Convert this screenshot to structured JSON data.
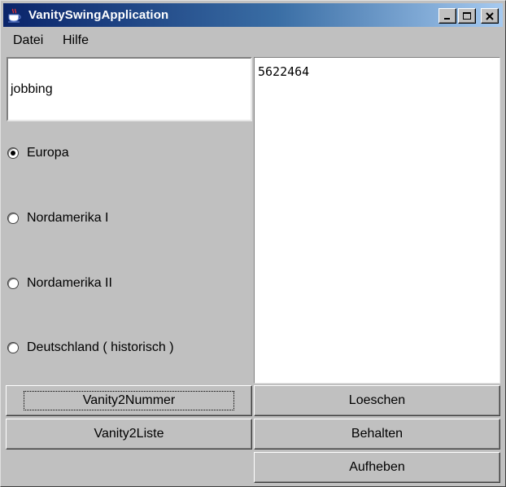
{
  "window": {
    "title": "VanitySwingApplication",
    "colors": {
      "titlebar_start": "#0a246a",
      "titlebar_end": "#a6caf0",
      "panel": "#c0c0c0"
    }
  },
  "menu": {
    "items": [
      {
        "label": "Datei"
      },
      {
        "label": "Hilfe"
      }
    ]
  },
  "input": {
    "value": "jobbing"
  },
  "regions": {
    "selected": "Europa",
    "options": [
      {
        "label": "Europa",
        "checked": true
      },
      {
        "label": "Nordamerika I",
        "checked": false
      },
      {
        "label": "Nordamerika II",
        "checked": false
      },
      {
        "label": "Deutschland ( historisch )",
        "checked": false
      }
    ]
  },
  "output": {
    "text": "5622464"
  },
  "buttons": {
    "vanity2nummer": "Vanity2Nummer",
    "loeschen": "Loeschen",
    "vanity2liste": "Vanity2Liste",
    "behalten": "Behalten",
    "aufheben": "Aufheben"
  },
  "icons": {
    "app": "java-coffee-cup-icon",
    "minimize": "minimize-icon",
    "maximize": "maximize-icon",
    "close": "close-icon"
  }
}
